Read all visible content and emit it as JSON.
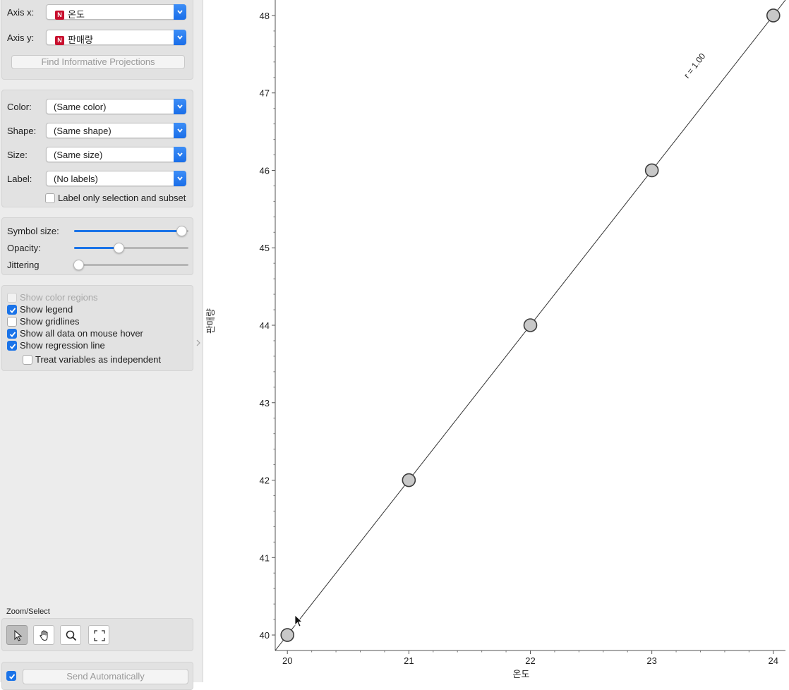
{
  "axes": {
    "x_label": "Axis x:",
    "x_value": "온도",
    "y_label": "Axis y:",
    "y_value": "판매량",
    "var_type_badge": "N",
    "find_projections": "Find Informative Projections"
  },
  "attributes": {
    "color_label": "Color:",
    "color_value": "(Same color)",
    "shape_label": "Shape:",
    "shape_value": "(Same shape)",
    "size_label": "Size:",
    "size_value": "(Same size)",
    "label_label": "Label:",
    "label_value": "(No labels)",
    "label_only_selection": "Label only selection and subset",
    "label_only_selection_checked": false
  },
  "sliders": {
    "symbol_size_label": "Symbol size:",
    "symbol_size": 0.95,
    "opacity_label": "Opacity:",
    "opacity": 0.37,
    "jittering_label": "Jittering",
    "jittering": 0.0
  },
  "options": [
    {
      "label": "Show color regions",
      "checked": false,
      "disabled": true
    },
    {
      "label": "Show legend",
      "checked": true,
      "disabled": false
    },
    {
      "label": "Show gridlines",
      "checked": false,
      "disabled": false
    },
    {
      "label": "Show all data on mouse hover",
      "checked": true,
      "disabled": false
    },
    {
      "label": "Show regression line",
      "checked": true,
      "disabled": false
    },
    {
      "label": "Treat variables as independent",
      "checked": false,
      "disabled": false
    }
  ],
  "zoom": {
    "title": "Zoom/Select",
    "tools": [
      "select-tool-icon",
      "pan-hand-icon",
      "zoom-magnifier-icon",
      "reset-zoom-icon"
    ],
    "active_tool": 0
  },
  "send": {
    "auto_checked": true,
    "label": "Send Automatically"
  },
  "colors": {
    "accent": "#1a73e8",
    "point_fill": "#c8c8c8",
    "point_stroke": "#3c3c3c"
  },
  "chart_data": {
    "type": "scatter",
    "xlabel": "온도",
    "ylabel": "판매량",
    "x": [
      20,
      21,
      22,
      23,
      24
    ],
    "y": [
      40,
      42,
      44,
      46,
      48
    ],
    "xlim": [
      19.9,
      24.1
    ],
    "ylim": [
      39.8,
      48.2
    ],
    "x_ticks": [
      20,
      21,
      22,
      23,
      24
    ],
    "y_ticks": [
      40,
      41,
      42,
      43,
      44,
      45,
      46,
      47,
      48
    ],
    "regression_annotation": "r = 1.00",
    "grid": false
  }
}
